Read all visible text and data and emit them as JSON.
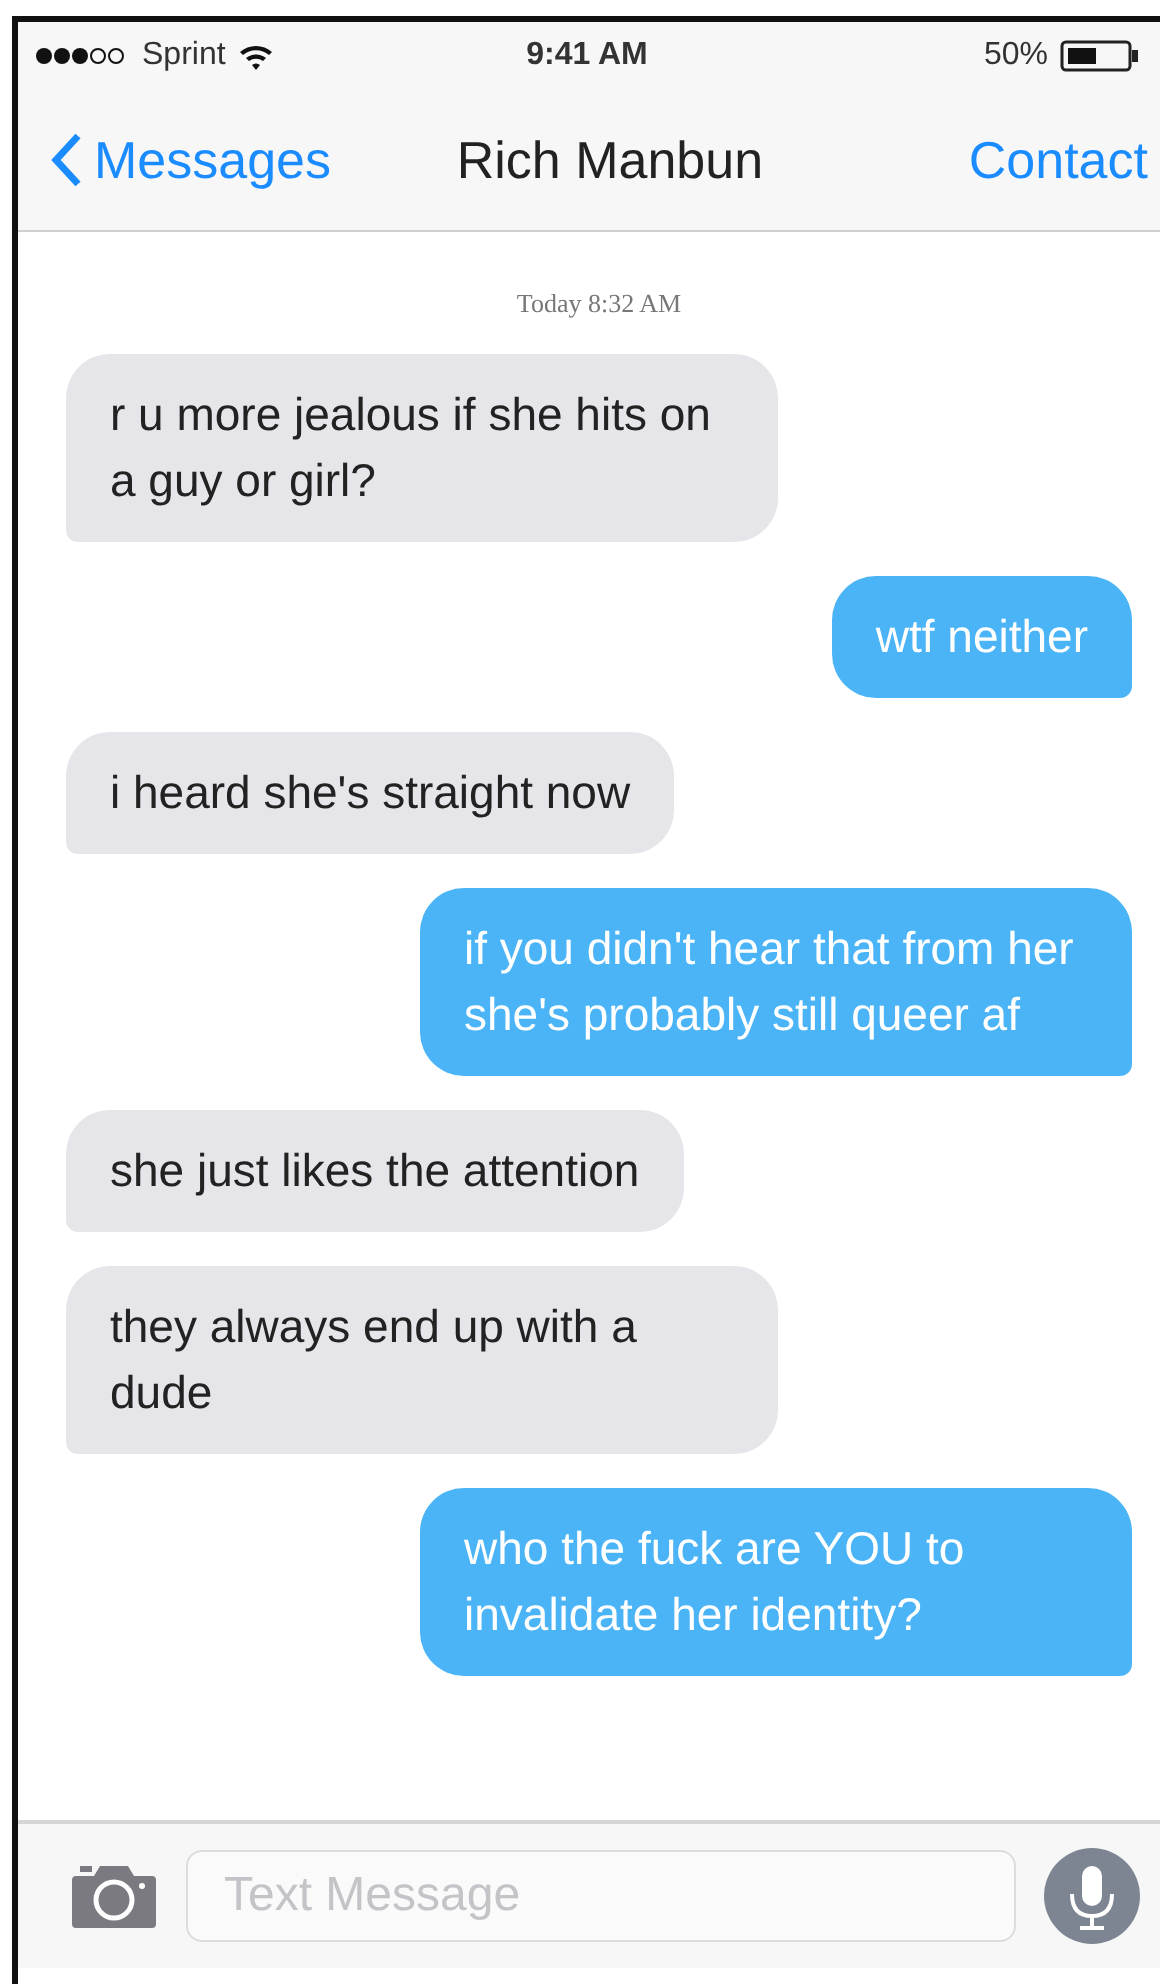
{
  "status_bar": {
    "carrier": "Sprint",
    "time": "9:41 AM",
    "battery": "50%"
  },
  "nav_bar": {
    "back": "Messages",
    "title": "Rich Manbun",
    "action": "Contact"
  },
  "timestamp": "Today 8:32 AM",
  "messages": [
    {
      "kind": "received",
      "text": "r u more jealous if she hits on a guy or girl?"
    },
    {
      "kind": "sent",
      "text": "wtf neither"
    },
    {
      "kind": "received",
      "text": "i heard she's straight now"
    },
    {
      "kind": "sent",
      "text": "if you didn't hear that from her she's probably still queer af"
    },
    {
      "kind": "received",
      "text": "she just likes the attention"
    },
    {
      "kind": "received",
      "text": "they always end up with a dude"
    },
    {
      "kind": "sent",
      "text": "who the fuck are YOU to invalidate her identity?"
    }
  ],
  "input": {
    "placeholder": "Text Message"
  }
}
